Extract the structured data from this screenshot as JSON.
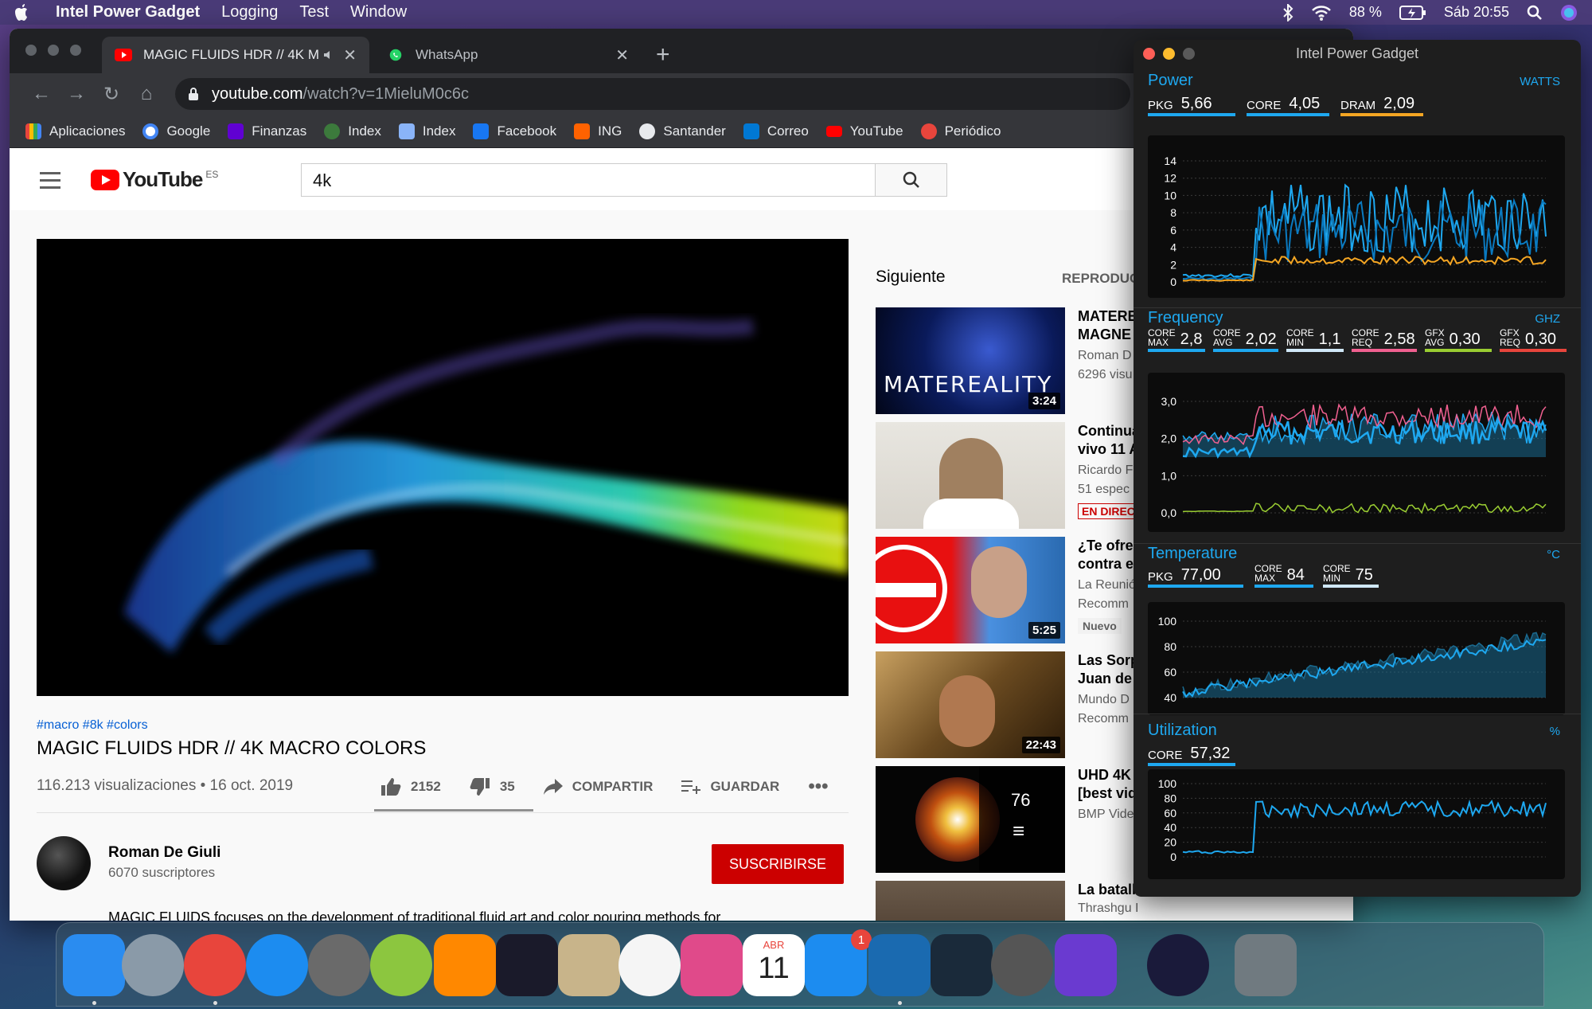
{
  "menubar": {
    "app_name": "Intel Power Gadget",
    "items": [
      "Logging",
      "Test",
      "Window"
    ],
    "battery": "88 %",
    "clock": "Sáb 20:55"
  },
  "browser": {
    "tabs": [
      {
        "label": "MAGIC FLUIDS HDR // 4K M",
        "icon": "youtube-icon",
        "audio": true
      },
      {
        "label": "WhatsApp",
        "icon": "whatsapp-icon"
      }
    ],
    "url_host": "youtube.com",
    "url_path": "/watch?v=1MieluM0c6c",
    "bookmarks": [
      {
        "label": "Aplicaciones",
        "color": "#e8453c"
      },
      {
        "label": "Google",
        "color": "#ffffff"
      },
      {
        "label": "Finanzas",
        "color": "#6001d2"
      },
      {
        "label": "Index",
        "color": "#3c7a3c"
      },
      {
        "label": "Index",
        "color": "#8ab4f8"
      },
      {
        "label": "Facebook",
        "color": "#1877f2"
      },
      {
        "label": "ING",
        "color": "#ff6200"
      },
      {
        "label": "Santander",
        "color": "#e8eaed"
      },
      {
        "label": "Correo",
        "color": "#0078d4"
      },
      {
        "label": "YouTube",
        "color": "#ff0000"
      },
      {
        "label": "Periódico",
        "color": "#e8453c"
      }
    ]
  },
  "youtube": {
    "logo_text": "YouTube",
    "country": "ES",
    "search_query": "4k",
    "hashtags": "#macro #8k #colors",
    "title": "MAGIC FLUIDS HDR // 4K MACRO COLORS",
    "views": "116.213 visualizaciones • 16 oct. 2019",
    "likes": "2152",
    "dislikes": "35",
    "share": "COMPARTIR",
    "save": "GUARDAR",
    "channel": "Roman De Giuli",
    "subscribers": "6070 suscriptores",
    "subscribe": "SUSCRIBIRSE",
    "description": "MAGIC FLUIDS focuses on the development of traditional fluid art and color pouring methods for",
    "up_next": "Siguiente",
    "autoplay": "REPRODUC",
    "recommendations": [
      {
        "title": "MATERE\nMAGNE",
        "meta1": "Roman D",
        "meta2": "6296 visu",
        "duration": "3:24",
        "thumb_text": "MATEREALITY"
      },
      {
        "title": "Continua\nvivo 11 A",
        "meta1": "Ricardo F",
        "meta2": "51 espec",
        "badge": "EN DIREC"
      },
      {
        "title": "¿Te ofrec\ncontra el",
        "meta1": "La Reunió",
        "meta2": "Recomm",
        "duration": "5:25",
        "badge": "Nuevo"
      },
      {
        "title": "Las Sorp\nJuan de",
        "meta1": "Mundo D",
        "meta2": "Recomm",
        "duration": "22:43"
      },
      {
        "title": "UHD 4K\n[best vid",
        "meta1": "BMP Vide",
        "playlist_count": "76"
      },
      {
        "title": "La batall",
        "meta1": "Thrashgu I"
      }
    ]
  },
  "power_gadget": {
    "window_title": "Intel Power Gadget",
    "power": {
      "title": "Power",
      "unit": "WATTS",
      "metrics": [
        {
          "label": "PKG",
          "value": "5,66",
          "color": "#1ea8f0"
        },
        {
          "label": "CORE",
          "value": "4,05",
          "color": "#1ea8f0"
        },
        {
          "label": "DRAM",
          "value": "2,09",
          "color": "#f5a623"
        }
      ],
      "y_ticks": [
        "14",
        "12",
        "10",
        "8",
        "6",
        "4",
        "2",
        "0"
      ]
    },
    "frequency": {
      "title": "Frequency",
      "unit": "GHZ",
      "metrics": [
        {
          "top": "CORE",
          "bottom": "MAX",
          "value": "2,8",
          "color": "#1ea8f0"
        },
        {
          "top": "CORE",
          "bottom": "AVG",
          "value": "2,02",
          "color": "#1ea8f0"
        },
        {
          "top": "CORE",
          "bottom": "MIN",
          "value": "1,1",
          "color": "#d0e8f8"
        },
        {
          "top": "CORE",
          "bottom": "REQ",
          "value": "2,58",
          "color": "#f06090"
        },
        {
          "top": "GFX",
          "bottom": "AVG",
          "value": "0,30",
          "color": "#9acd32"
        },
        {
          "top": "GFX",
          "bottom": "REQ",
          "value": "0,30",
          "color": "#e8453c"
        }
      ],
      "y_ticks": [
        "3,0",
        "2,0",
        "1,0",
        "0,0"
      ]
    },
    "temperature": {
      "title": "Temperature",
      "unit": "°C",
      "metrics": [
        {
          "label": "PKG",
          "value": "77,00",
          "color": "#1ea8f0"
        },
        {
          "top": "CORE",
          "bottom": "MAX",
          "value": "84",
          "color": "#1ea8f0"
        },
        {
          "top": "CORE",
          "bottom": "MIN",
          "value": "75",
          "color": "#d0e8f8"
        }
      ],
      "y_ticks": [
        "100",
        "80",
        "60",
        "40"
      ]
    },
    "utilization": {
      "title": "Utilization",
      "unit": "%",
      "metrics": [
        {
          "label": "CORE",
          "value": "57,32",
          "color": "#1ea8f0"
        }
      ],
      "y_ticks": [
        "100",
        "80",
        "60",
        "40",
        "20",
        "0"
      ]
    }
  },
  "dock": {
    "apps": [
      {
        "name": "finder-icon",
        "color": "#2a8cf0"
      },
      {
        "name": "launchpad-icon",
        "color": "#8a9aa8"
      },
      {
        "name": "chrome-icon",
        "color": "#e8453c"
      },
      {
        "name": "safari-icon",
        "color": "#1c8cf0"
      },
      {
        "name": "system-preferences-icon",
        "color": "#6a6a6a"
      },
      {
        "name": "cloud-drive-icon",
        "color": "#8cc63f"
      },
      {
        "name": "vlc-icon",
        "color": "#ff8800"
      },
      {
        "name": "quicktime-icon",
        "color": "#1a1a2a"
      },
      {
        "name": "mail-stamp-icon",
        "color": "#c8b48a"
      },
      {
        "name": "photos-icon",
        "color": "#f5f5f5"
      },
      {
        "name": "screen-display-icon",
        "color": "#e04a8a"
      },
      {
        "name": "calendar-icon",
        "color": "#ffffff"
      },
      {
        "name": "app-store-icon",
        "color": "#1c8cf0"
      },
      {
        "name": "intel-power-gadget-icon",
        "color": "#1a6ab0"
      },
      {
        "name": "filmora-icon",
        "color": "#1a2a3a"
      },
      {
        "name": "final-cut-icon",
        "color": "#555555"
      },
      {
        "name": "imovie-icon",
        "color": "#6a3ad0"
      },
      {
        "name": "siri-icon",
        "color": "#1a1a3a"
      },
      {
        "name": "trash-icon",
        "color": "#707a80"
      }
    ],
    "calendar_month": "ABR",
    "calendar_day": "11",
    "app_store_badge": "1"
  }
}
